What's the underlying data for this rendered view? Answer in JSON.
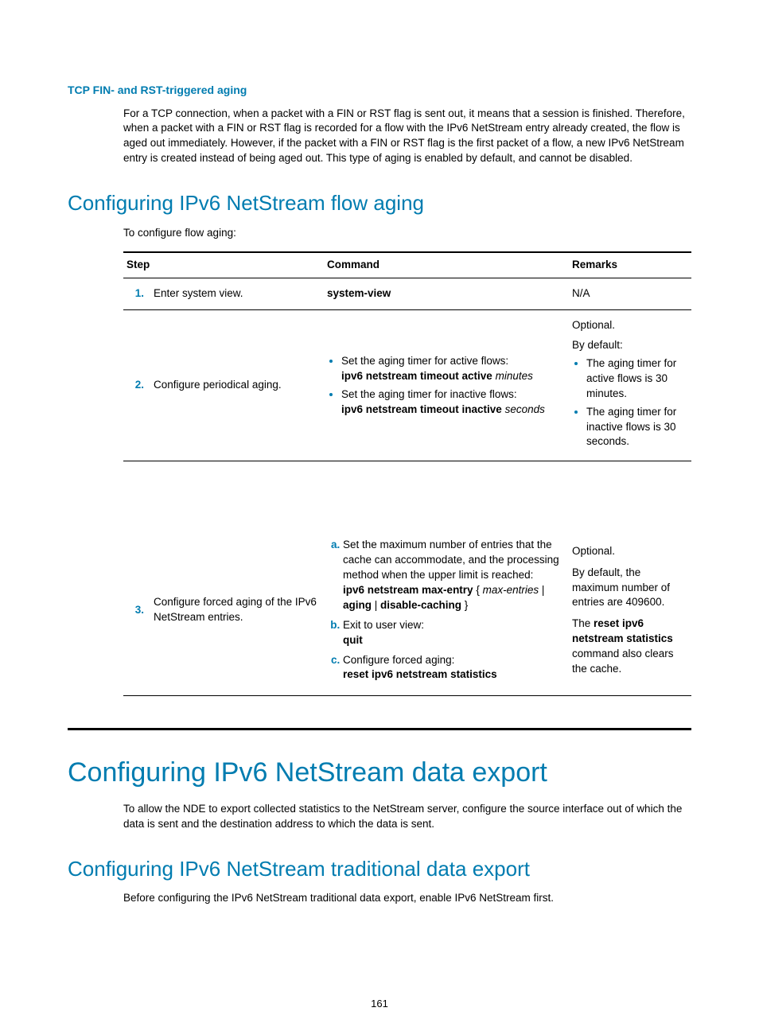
{
  "headings": {
    "h4": "TCP FIN- and RST-triggered aging",
    "h2a": "Configuring IPv6 NetStream flow aging",
    "h1": "Configuring IPv6 NetStream data export",
    "h2b": "Configuring IPv6 NetStream traditional data export"
  },
  "paras": {
    "p1": "For a TCP connection, when a packet with a FIN or RST flag is sent out, it means that a session is finished. Therefore, when a packet with a FIN or RST flag is recorded for a flow with the IPv6 NetStream entry already created, the flow is aged out immediately. However, if the packet with a FIN or RST flag is the first packet of a flow, a new IPv6 NetStream entry is created instead of being aged out. This type of aging is enabled by default, and cannot be disabled.",
    "p2": "To configure flow aging:",
    "p3": "To allow the NDE to export collected statistics to the NetStream server, configure the source interface out of which the data is sent and the destination address to which the data is sent.",
    "p4": "Before configuring the IPv6 NetStream traditional data export, enable IPv6 NetStream first."
  },
  "table": {
    "headers": {
      "step": "Step",
      "command": "Command",
      "remarks": "Remarks"
    },
    "rows": {
      "r1": {
        "num": "1.",
        "step": "Enter system view.",
        "cmd": "system-view",
        "rem": "N/A"
      },
      "r2": {
        "num": "2.",
        "step": "Configure periodical aging.",
        "cmd": {
          "b1a": "Set the aging timer for active flows:",
          "b1b_bold": "ipv6 netstream timeout active",
          "b1b_it": "minutes",
          "b2a": "Set the aging timer for inactive flows:",
          "b2b_bold": "ipv6 netstream timeout inactive",
          "b2b_it": "seconds"
        },
        "rem": {
          "l1": "Optional.",
          "l2": "By default:",
          "l3": "The aging timer for active flows is 30 minutes.",
          "l4": "The aging timer for inactive flows is 30 seconds."
        }
      },
      "r3": {
        "num": "3.",
        "step": "Configure forced aging of the IPv6 NetStream entries.",
        "cmd": {
          "a1": "Set the maximum number of entries that the cache can accommodate, and the processing method when the upper limit is reached:",
          "a2_bold1": "ipv6 netstream max-entry",
          "a2_txt1": " { ",
          "a2_it": "max-entries",
          "a2_txt2": " | ",
          "a2_bold2": "aging",
          "a2_txt3": " | ",
          "a2_bold3": "disable-caching",
          "a2_txt4": " }",
          "b1": "Exit to user view:",
          "b2": "quit",
          "c1": "Configure forced aging:",
          "c2": "reset ipv6 netstream statistics"
        },
        "rem": {
          "l1": "Optional.",
          "l2": "By default, the maximum number of entries are 409600.",
          "l3a": "The ",
          "l3b": "reset ipv6 netstream statistics",
          "l3c": " command also clears the cache."
        }
      }
    }
  },
  "page_number": "161"
}
